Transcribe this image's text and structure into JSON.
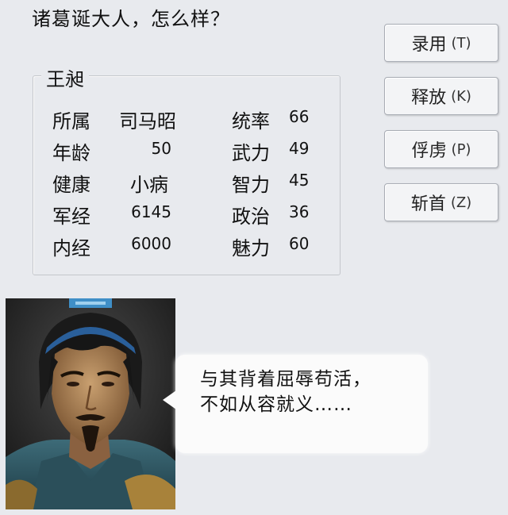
{
  "prompt": "诸葛诞大人，怎么样？",
  "actions": [
    {
      "label": "录用",
      "hotkey": "(T)"
    },
    {
      "label": "释放",
      "hotkey": "(K)"
    },
    {
      "label": "俘虏",
      "hotkey": "(P)"
    },
    {
      "label": "斩首",
      "hotkey": "(Z)"
    }
  ],
  "officer": {
    "name": "王昶",
    "stats_left": [
      {
        "label": "所属",
        "value": "司马昭"
      },
      {
        "label": "年龄",
        "value": "50"
      },
      {
        "label": "健康",
        "value": "小病"
      },
      {
        "label": "军经",
        "value": "6145"
      },
      {
        "label": "内经",
        "value": "6000"
      }
    ],
    "stats_right": [
      {
        "label": "统率",
        "value": "66"
      },
      {
        "label": "武力",
        "value": "49"
      },
      {
        "label": "智力",
        "value": "45"
      },
      {
        "label": "政治",
        "value": "36"
      },
      {
        "label": "魅力",
        "value": "60"
      }
    ]
  },
  "dialogue": {
    "line1": "与其背着屈辱苟活，",
    "line2": "不如从容就义……"
  }
}
